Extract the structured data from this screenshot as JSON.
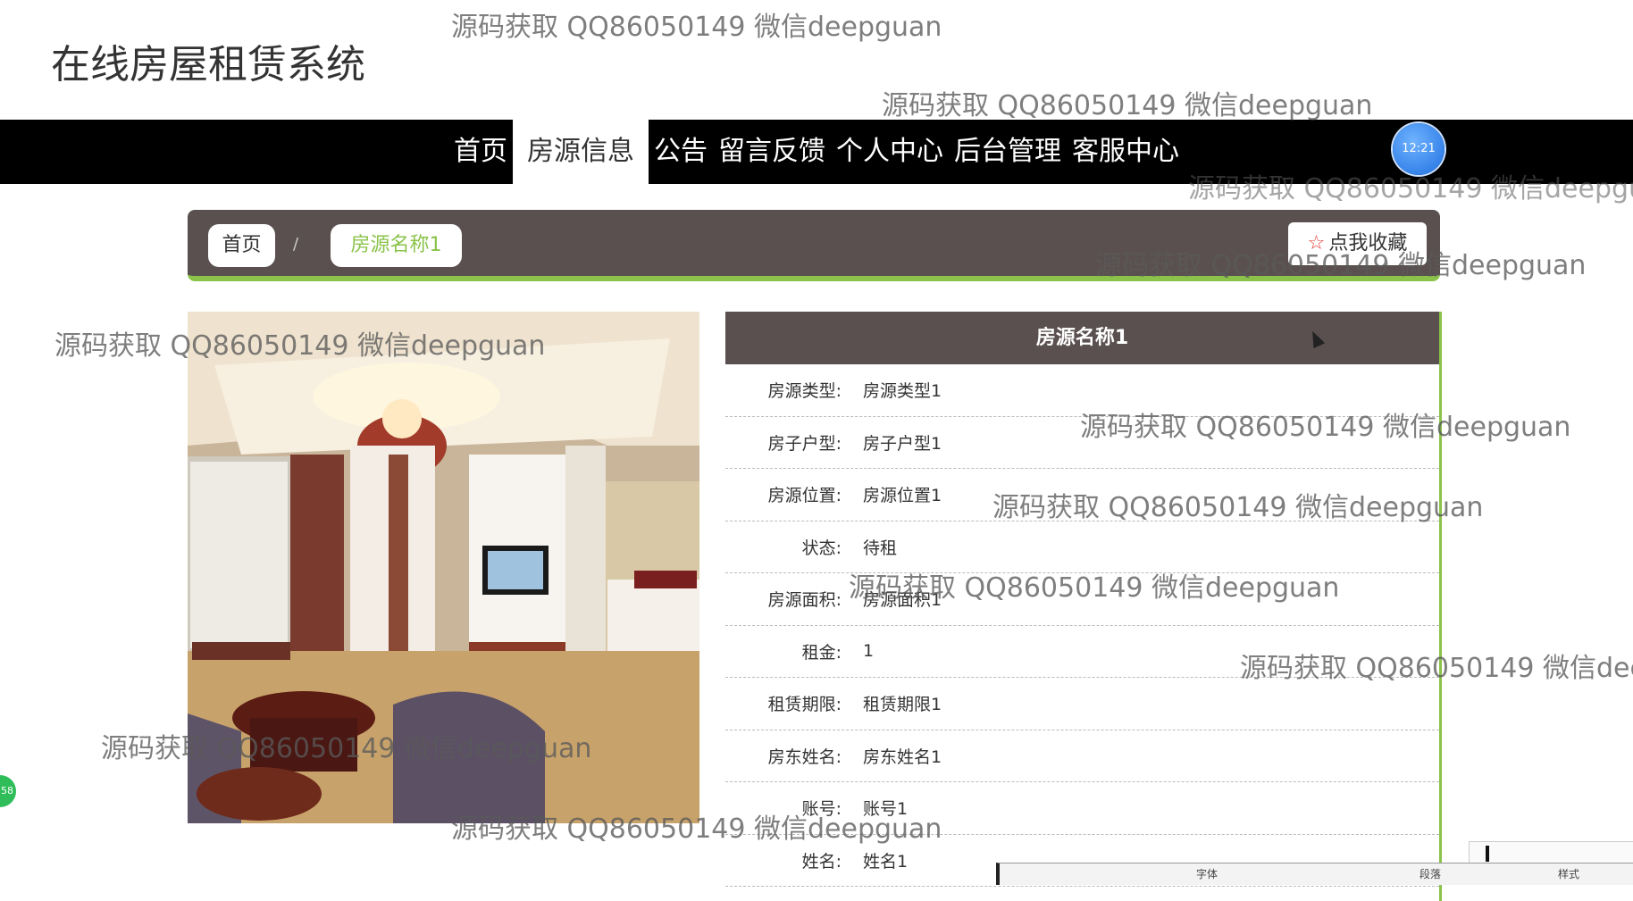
{
  "site": {
    "title": "在线房屋租赁系统"
  },
  "nav": {
    "items": [
      {
        "label": "首页",
        "active": false
      },
      {
        "label": "房源信息",
        "active": true
      },
      {
        "label": "公告",
        "active": false
      },
      {
        "label": "留言反馈",
        "active": false
      },
      {
        "label": "个人中心",
        "active": false
      },
      {
        "label": "后台管理",
        "active": false
      },
      {
        "label": "客服中心",
        "active": false
      }
    ]
  },
  "clock": {
    "time": "12:21"
  },
  "breadcrumb": {
    "home": "首页",
    "separator": "/",
    "current": "房源名称1"
  },
  "favorite": {
    "label": "点我收藏",
    "icon": "star-outline-icon"
  },
  "details": {
    "title": "房源名称1",
    "rows": [
      {
        "label": "房源类型:",
        "value": "房源类型1"
      },
      {
        "label": "房子户型:",
        "value": "房子户型1"
      },
      {
        "label": "房源位置:",
        "value": "房源位置1"
      },
      {
        "label": "状态:",
        "value": "待租"
      },
      {
        "label": "房源面积:",
        "value": "房源面积1"
      },
      {
        "label": "租金:",
        "value": "1"
      },
      {
        "label": "租赁期限:",
        "value": "租赁期限1"
      },
      {
        "label": "房东姓名:",
        "value": "房东姓名1"
      },
      {
        "label": "账号:",
        "value": "账号1"
      },
      {
        "label": "姓名:",
        "value": "姓名1"
      }
    ]
  },
  "side_badge": {
    "text": "58"
  },
  "taskbar": {
    "items": [
      "字体",
      "段落",
      "样式"
    ]
  },
  "watermark": {
    "text": "源码获取 QQ86050149 微信deepguan"
  },
  "colors": {
    "nav_bg": "#000000",
    "panel_bg": "#5b5050",
    "accent": "#8bc34a",
    "star": "#e53935"
  }
}
